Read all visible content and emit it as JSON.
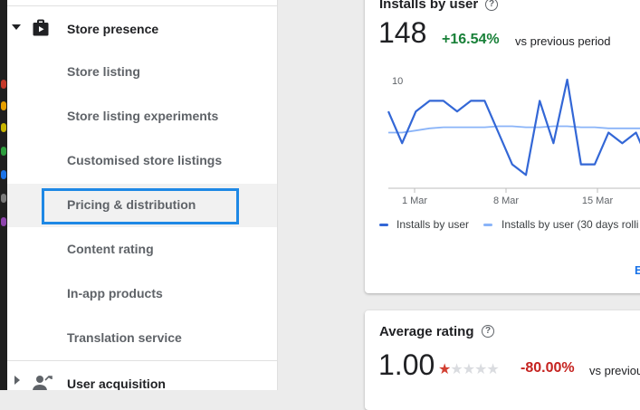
{
  "sidebar": {
    "section_title": "Store presence",
    "items": [
      {
        "label": "Store listing"
      },
      {
        "label": "Store listing experiments"
      },
      {
        "label": "Customised store listings"
      },
      {
        "label": "Pricing & distribution"
      },
      {
        "label": "Content rating"
      },
      {
        "label": "In-app products"
      },
      {
        "label": "Translation service"
      }
    ],
    "next_section_title": "User acquisition"
  },
  "installs_card": {
    "title": "Installs by user",
    "value": "148",
    "delta": "+16.54%",
    "vs_text": "vs previous period",
    "link_label": "E",
    "chart_data": {
      "type": "line",
      "x_ticks": [
        "1 Mar",
        "8 Mar",
        "15 Mar"
      ],
      "y_ticks": [
        "10"
      ],
      "series": [
        {
          "name": "Installs by user",
          "color": "#3367d6",
          "values": [
            7,
            4,
            7,
            8,
            8,
            7,
            8,
            8,
            5,
            2,
            1,
            8,
            4,
            10,
            2,
            2,
            5,
            4,
            5,
            2,
            5
          ]
        },
        {
          "name": "Installs by user (30 days rolli",
          "color": "#8ab4f8",
          "values": [
            5,
            5,
            5.2,
            5.4,
            5.5,
            5.5,
            5.5,
            5.5,
            5.6,
            5.6,
            5.5,
            5.5,
            5.6,
            5.6,
            5.5,
            5.5,
            5.4,
            5.4,
            5.4,
            5.4,
            5.5
          ]
        }
      ]
    }
  },
  "rating_card": {
    "title": "Average rating",
    "value": "1.00",
    "rating": 1,
    "rating_max": 5,
    "delta": "-80.00%",
    "vs_text": "vs previou"
  }
}
